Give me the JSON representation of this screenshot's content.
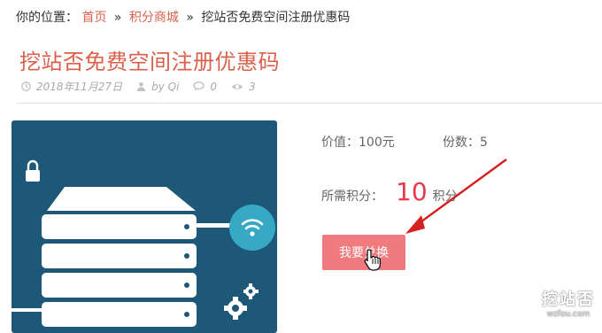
{
  "breadcrumb": {
    "prefix": "你的位置：",
    "home": "首页",
    "category": "积分商城",
    "separator": "»",
    "current": "挖站否免费空间注册优惠码"
  },
  "page_title": "挖站否免费空间注册优惠码",
  "meta": {
    "date": "2018年11月27日",
    "author": "by Qi",
    "comments": "0",
    "views": "3",
    "icons": [
      "clock-icon",
      "user-icon",
      "comment-icon",
      "eye-icon"
    ]
  },
  "product": {
    "value_label": "价值：",
    "value": "100元",
    "quantity_label": "份数：",
    "quantity": "5",
    "points_label": "所需积分：",
    "points": "10",
    "points_unit": "积分",
    "redeem_button": "我要兑换"
  },
  "watermark": {
    "text": "挖站否",
    "url": "wzfou.com"
  },
  "colors": {
    "accent": "#d9614c",
    "points": "#e8384f",
    "button": "#f07b7f",
    "image_bg": "#1e5878",
    "arrow": "#d42020"
  }
}
